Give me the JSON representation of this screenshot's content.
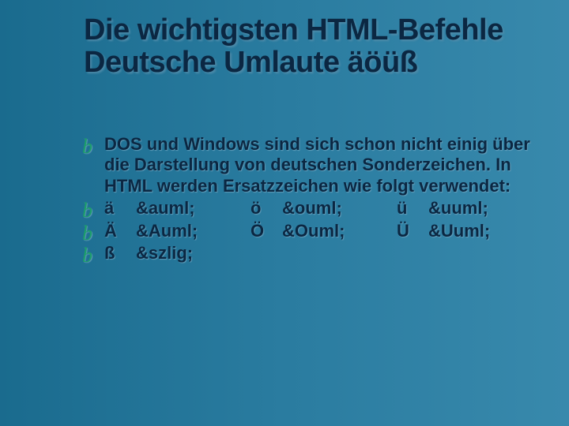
{
  "title_line1": "Die wichtigsten HTML-Befehle",
  "title_line2": "Deutsche Umlaute äöüß",
  "bullet_glyph": "b",
  "para": "DOS und Windows sind sich schon nicht einig über die Darstellung von deutschen Sonderzeichen. In HTML werden Ersatzzeichen wie folgt verwendet:",
  "rows": [
    {
      "a": "ä",
      "ac": "&auml;",
      "o": "ö",
      "oc": "&ouml;",
      "u": "ü",
      "uc": "&uuml;"
    },
    {
      "a": "Ä",
      "ac": "&Auml;",
      "o": "Ö",
      "oc": "&Ouml;",
      "u": "Ü",
      "uc": "&Uuml;"
    }
  ],
  "last": {
    "a": "ß",
    "ac": "&szlig;"
  }
}
